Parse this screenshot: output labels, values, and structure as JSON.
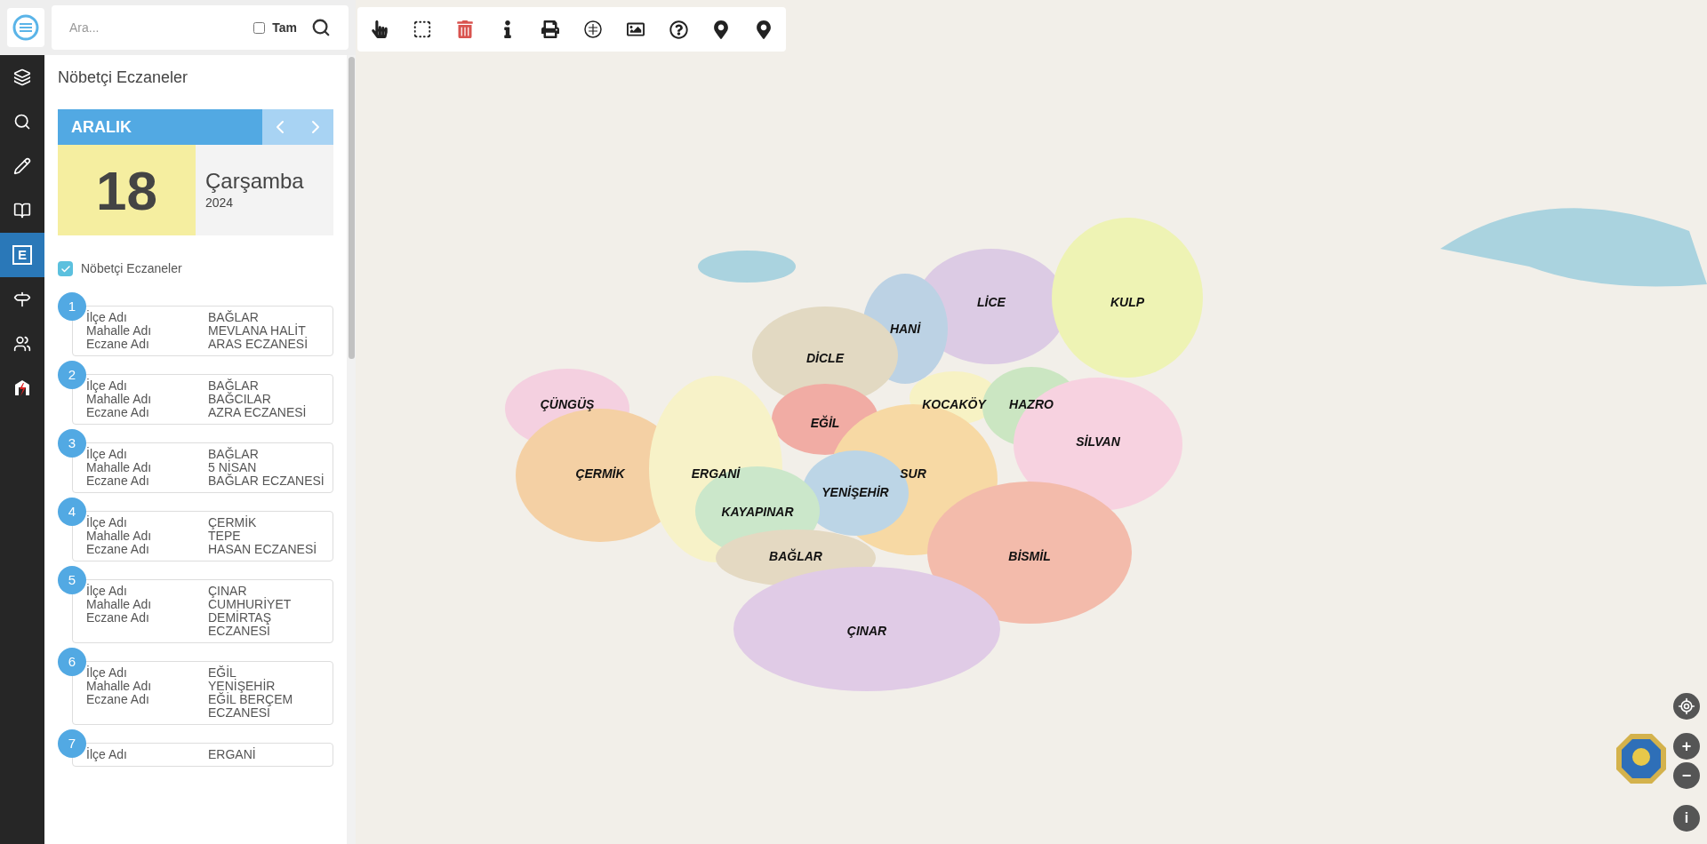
{
  "search": {
    "placeholder": "Ara...",
    "exact": {
      "label": "Tam",
      "checked": false
    }
  },
  "rail": [
    {
      "kind": "layers",
      "selected": false
    },
    {
      "kind": "search",
      "selected": false
    },
    {
      "kind": "pencil",
      "selected": false
    },
    {
      "kind": "book",
      "selected": false
    },
    {
      "kind": "letter",
      "label": "E",
      "selected": true
    },
    {
      "kind": "signpost",
      "selected": false
    },
    {
      "kind": "people",
      "selected": false
    },
    {
      "kind": "logo",
      "selected": false
    }
  ],
  "panel": {
    "title": "Nöbetçi Eczaneler",
    "calendar": {
      "month": "ARALIK",
      "day": "18",
      "weekday": "Çarşamba",
      "year": "2024"
    },
    "layer_toggle": {
      "label": "Nöbetçi Eczaneler",
      "checked": true
    },
    "cards": [
      {
        "number": "1",
        "rows": [
          {
            "label": "İlçe Adı",
            "value": "BAĞLAR"
          },
          {
            "label": "Mahalle Adı",
            "value": "MEVLANA HALİT"
          },
          {
            "label": "Eczane Adı",
            "value": "ARAS ECZANESİ"
          }
        ]
      },
      {
        "number": "2",
        "rows": [
          {
            "label": "İlçe Adı",
            "value": "BAĞLAR"
          },
          {
            "label": "Mahalle Adı",
            "value": "BAĞCILAR"
          },
          {
            "label": "Eczane Adı",
            "value": "AZRA ECZANESİ"
          }
        ]
      },
      {
        "number": "3",
        "rows": [
          {
            "label": "İlçe Adı",
            "value": "BAĞLAR"
          },
          {
            "label": "Mahalle Adı",
            "value": "5 NİSAN"
          },
          {
            "label": "Eczane Adı",
            "value": "BAĞLAR ECZANESİ"
          }
        ]
      },
      {
        "number": "4",
        "rows": [
          {
            "label": "İlçe Adı",
            "value": "ÇERMİK"
          },
          {
            "label": "Mahalle Adı",
            "value": "TEPE"
          },
          {
            "label": "Eczane Adı",
            "value": "HASAN ECZANESİ"
          }
        ]
      },
      {
        "number": "5",
        "rows": [
          {
            "label": "İlçe Adı",
            "value": "ÇINAR"
          },
          {
            "label": "Mahalle Adı",
            "value": "CUMHURİYET"
          },
          {
            "label": "Eczane Adı",
            "value": "DEMİRTAŞ ECZANESİ"
          }
        ]
      },
      {
        "number": "6",
        "rows": [
          {
            "label": "İlçe Adı",
            "value": "EĞİL"
          },
          {
            "label": "Mahalle Adı",
            "value": "YENİŞEHİR"
          },
          {
            "label": "Eczane Adı",
            "value": "EĞİL BERÇEM ECZANESİ"
          }
        ]
      },
      {
        "number": "7",
        "rows": [
          {
            "label": "İlçe Adı",
            "value": "ERGANİ"
          }
        ]
      }
    ]
  },
  "map": {
    "districts": [
      {
        "name": "LİCE",
        "color": "#dccbe4"
      },
      {
        "name": "KULP",
        "color": "#eef3b4"
      },
      {
        "name": "HANİ",
        "color": "#bcd2e4"
      },
      {
        "name": "DİCLE",
        "color": "#e2d9c2"
      },
      {
        "name": "ÇÜNGÜŞ",
        "color": "#f4d0e0"
      },
      {
        "name": "KOCAKÖY",
        "color": "#f7f2c4"
      },
      {
        "name": "HAZRO",
        "color": "#cbe6c2"
      },
      {
        "name": "EĞİL",
        "color": "#f1aca4"
      },
      {
        "name": "SİLVAN",
        "color": "#f7d2e0"
      },
      {
        "name": "ÇERMİK",
        "color": "#f4d0a4"
      },
      {
        "name": "ERGANİ",
        "color": "#f7f2c8"
      },
      {
        "name": "SUR",
        "color": "#f7d9a4"
      },
      {
        "name": "YENİŞEHİR",
        "color": "#bcd5e6"
      },
      {
        "name": "KAYAPINAR",
        "color": "#cbe7ca"
      },
      {
        "name": "BAĞLAR",
        "color": "#e4d9c2"
      },
      {
        "name": "BİSMİL",
        "color": "#f3bbab"
      },
      {
        "name": "ÇINAR",
        "color": "#e0cbe6"
      }
    ],
    "zoom_in": "+",
    "zoom_out": "−",
    "info": "i"
  }
}
